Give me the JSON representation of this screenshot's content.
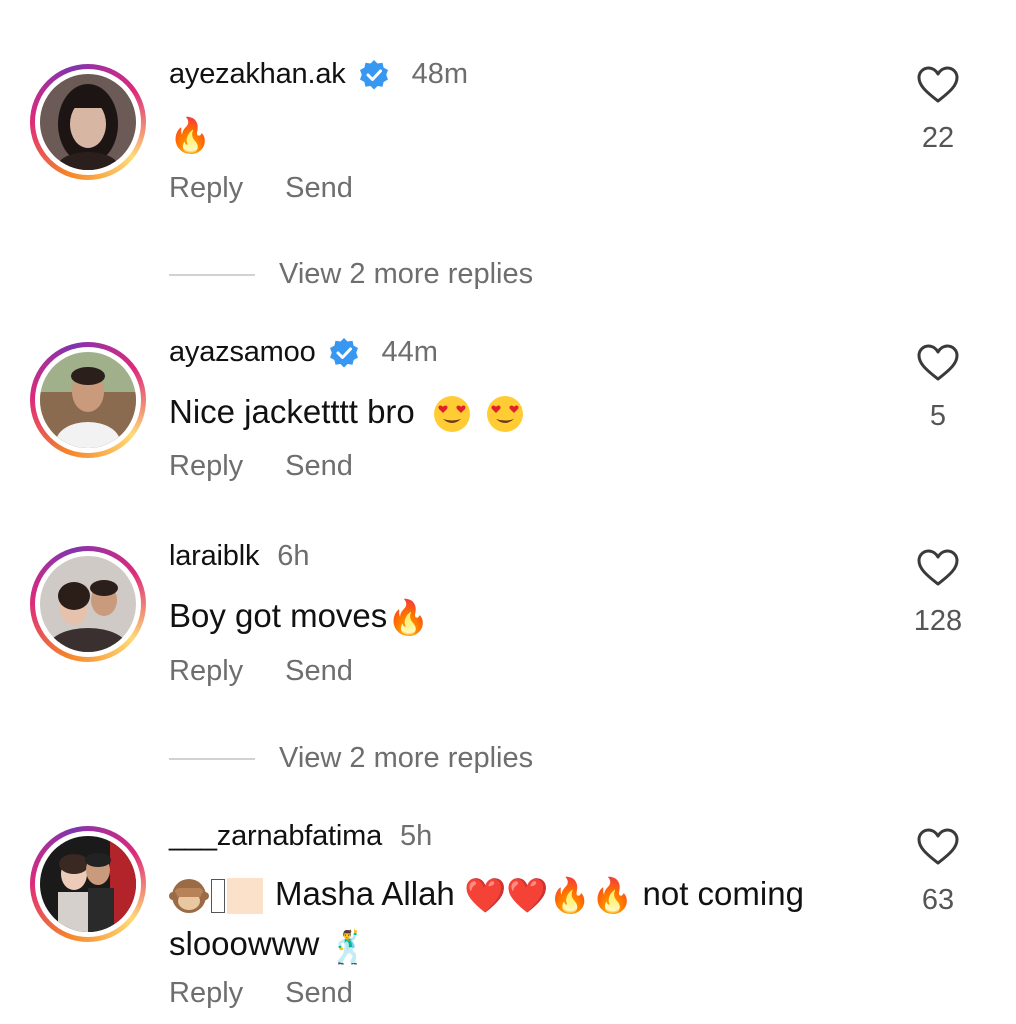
{
  "comments": [
    {
      "username": "ayezakhan.ak",
      "verified": true,
      "time": "48m",
      "text_emoji": "🔥",
      "likes": "22",
      "reply_label": "Reply",
      "send_label": "Send",
      "view_replies": "View 2 more replies"
    },
    {
      "username": "ayazsamoo",
      "verified": true,
      "time": "44m",
      "text": "Nice jacketttt bro",
      "text_emojis": [
        "😍",
        "😍"
      ],
      "likes": "5",
      "reply_label": "Reply",
      "send_label": "Send"
    },
    {
      "username": "laraiblk",
      "verified": false,
      "time": "6h",
      "text": "Boy got moves",
      "text_emoji": "🔥",
      "likes": "128",
      "reply_label": "Reply",
      "send_label": "Send",
      "view_replies": "View 2 more replies"
    },
    {
      "username": "___zarnabfatima",
      "verified": false,
      "time": "5h",
      "text_prefix_emoji": "🙈",
      "text_main": "Masha Allah",
      "text_hearts": [
        "❤️",
        "❤️"
      ],
      "text_fires": [
        "🔥",
        "🔥"
      ],
      "text_tail": "not coming",
      "text_line2": "slooowww",
      "text_line2_emoji": "🕺",
      "likes": "63",
      "reply_label": "Reply",
      "send_label": "Send"
    }
  ],
  "colors": {
    "verified_blue": "#3897f0",
    "secondary_text": "#6e6e6e",
    "primary_text": "#111111"
  },
  "icons": {
    "like": "heart-outline-icon",
    "verified": "verified-badge-icon"
  }
}
